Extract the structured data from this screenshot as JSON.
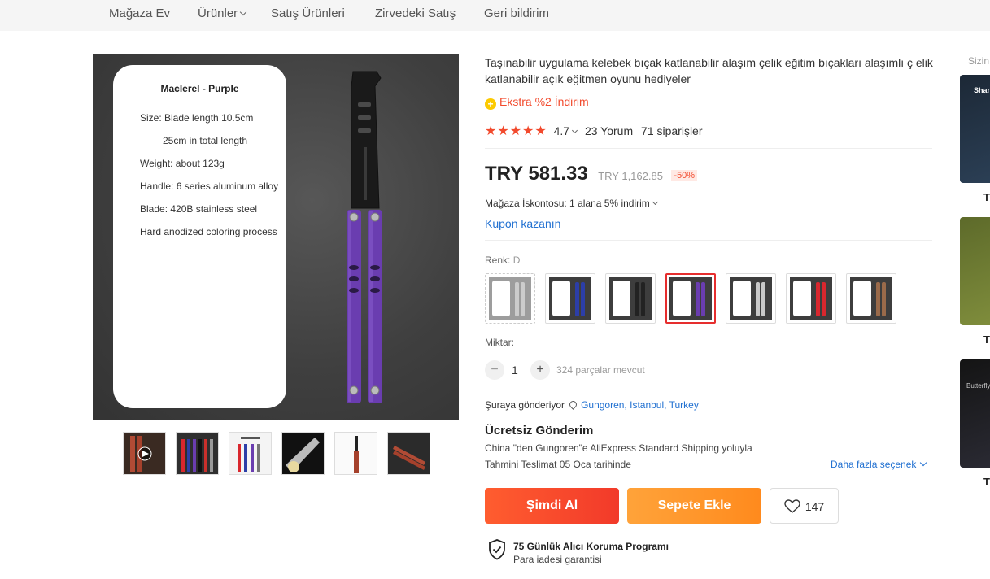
{
  "nav": {
    "items": [
      "Mağaza Ev",
      "Ürünler",
      "Satış Ürünleri",
      "Zirvedeki Satış",
      "Geri bildirim"
    ]
  },
  "product_image": {
    "card_title": "Maclerel - Purple",
    "specs": [
      "Size: Blade length 10.5cm",
      "25cm in total length",
      "Weight: about 123g",
      "Handle: 6 series aluminum alloy",
      "Blade: 420B stainless steel",
      "Hard anodized coloring process"
    ],
    "handle_color": "#6a3db0"
  },
  "product": {
    "title": "Taşınabilir uygulama kelebek bıçak katlanabilir alaşım çelik eğitim bıçakları alaşımlı ç elik katlanabilir açık eğitmen oyunu hediyeler",
    "extra_discount": "Ekstra %2 İndirim",
    "extra_icon": "+",
    "stars": "★★★★★",
    "rating": "4.7",
    "reviews": "23 Yorum",
    "orders": "71 siparişler",
    "price": "TRY 581.33",
    "old_price": "TRY 1,162.85",
    "discount": "-50%",
    "store_discount": "Mağaza İskontosu: 1 alana 5% indirim",
    "coupon": "Kupon kazanın",
    "color_label": "Renk:",
    "color_value": "D",
    "swatch_colors": [
      "#9a9a9a",
      "#2c3ea8",
      "#222222",
      "#6a3db0",
      "#c8c8c8",
      "#d9272e",
      "#9a6a4a"
    ],
    "qty_label": "Miktar:",
    "qty_minus": "−",
    "qty_plus": "+",
    "qty": "1",
    "available": "324 parçalar mevcut",
    "ship_to_label": "Şuraya gönderiyor",
    "ship_to_location": "Gungoren, Istanbul, Turkey",
    "free_shipping": "Ücretsiz Gönderim",
    "ship_route": "China \"den Gungoren\"e AliExpress Standard Shipping yoluyla",
    "delivery": "Tahmini Teslimat 05 Oca tarihinde",
    "more_options": "Daha fazla seçenek",
    "buy_now": "Şimdi Al",
    "add_to_cart": "Sepete Ekle",
    "wishlist_count": "147",
    "protection_title": "75 Günlük Alıcı Koruma Programı",
    "protection_sub": "Para iadesi garantisi"
  },
  "sidebar": {
    "label": "Sizin",
    "items": [
      {
        "caption": "T",
        "overlay_text": "Shar"
      },
      {
        "caption": "T",
        "overlay_text": ""
      },
      {
        "caption": "T",
        "overlay_text": "Butterfly"
      }
    ]
  }
}
